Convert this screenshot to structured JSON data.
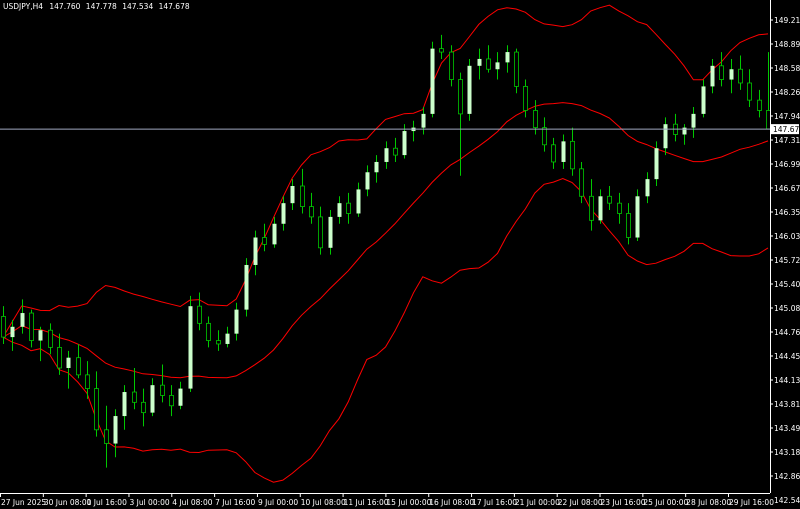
{
  "chart_data": {
    "type": "candlestick",
    "symbol": "USDJPY",
    "timeframe": "H4",
    "ohlc_header": {
      "open": "147.760",
      "high": "147.778",
      "low": "147.534",
      "close": "147.678"
    },
    "current_price": "147.678",
    "y_ticks": [
      "149.215",
      "148.890",
      "148.580",
      "148.260",
      "147.945",
      "147.310",
      "146.990",
      "146.670",
      "146.355",
      "146.035",
      "145.720",
      "145.400",
      "145.085",
      "144.765",
      "144.450",
      "144.130",
      "143.815",
      "143.495",
      "143.180",
      "142.860",
      "142.540"
    ],
    "y_range": [
      142.54,
      149.5
    ],
    "x_ticks": [
      "27 Jun 2025",
      "30 Jun 08:00",
      "1 Jul 16:00",
      "3 Jul 00:00",
      "4 Jul 08:00",
      "7 Jul 16:00",
      "9 Jul 00:00",
      "10 Jul 08:00",
      "11 Jul 16:00",
      "15 Jul 00:00",
      "16 Jul 08:00",
      "17 Jul 16:00",
      "21 Jul 00:00",
      "22 Jul 08:00",
      "23 Jul 16:00",
      "25 Jul 00:00",
      "28 Jul 08:00",
      "29 Jul 16:00"
    ],
    "indicator": "Bollinger Bands",
    "colors": {
      "background": "#000000",
      "bull_candle": "#ccffcc",
      "wick": "#00c800",
      "bear_candle": "#000000",
      "bands": "#ff0000",
      "axis_text": "#ffffff",
      "price_line": "#a0a8c0"
    },
    "candles": [
      [
        144.95,
        145.1,
        144.55,
        144.65
      ],
      [
        144.65,
        144.9,
        144.45,
        144.8
      ],
      [
        144.8,
        145.2,
        144.7,
        145.0
      ],
      [
        145.0,
        145.05,
        144.5,
        144.6
      ],
      [
        144.6,
        144.8,
        144.3,
        144.75
      ],
      [
        144.75,
        144.85,
        144.4,
        144.5
      ],
      [
        144.5,
        144.7,
        144.1,
        144.2
      ],
      [
        144.2,
        144.45,
        143.9,
        144.35
      ],
      [
        144.35,
        144.55,
        144.05,
        144.1
      ],
      [
        144.1,
        144.3,
        143.75,
        143.9
      ],
      [
        143.9,
        144.15,
        143.2,
        143.3
      ],
      [
        143.3,
        143.65,
        142.75,
        143.1
      ],
      [
        143.1,
        143.6,
        142.9,
        143.5
      ],
      [
        143.5,
        143.95,
        143.3,
        143.85
      ],
      [
        143.85,
        144.2,
        143.6,
        143.7
      ],
      [
        143.7,
        143.9,
        143.35,
        143.55
      ],
      [
        143.55,
        144.05,
        143.5,
        143.95
      ],
      [
        143.95,
        144.25,
        143.7,
        143.8
      ],
      [
        143.8,
        143.95,
        143.5,
        143.65
      ],
      [
        143.65,
        144.0,
        143.6,
        143.9
      ],
      [
        143.9,
        145.25,
        143.85,
        145.1
      ],
      [
        145.1,
        145.3,
        144.75,
        144.85
      ],
      [
        144.85,
        144.95,
        144.5,
        144.6
      ],
      [
        144.6,
        144.75,
        144.45,
        144.55
      ],
      [
        144.55,
        144.8,
        144.5,
        144.7
      ],
      [
        144.7,
        145.15,
        144.6,
        145.05
      ],
      [
        145.05,
        145.8,
        144.95,
        145.7
      ],
      [
        145.7,
        146.2,
        145.55,
        146.1
      ],
      [
        146.1,
        146.3,
        145.9,
        146.0
      ],
      [
        146.0,
        146.4,
        145.95,
        146.3
      ],
      [
        146.3,
        146.7,
        146.2,
        146.6
      ],
      [
        146.6,
        146.95,
        146.5,
        146.85
      ],
      [
        146.85,
        147.1,
        146.45,
        146.55
      ],
      [
        146.55,
        146.75,
        146.3,
        146.4
      ],
      [
        146.4,
        146.55,
        145.85,
        145.95
      ],
      [
        145.95,
        146.5,
        145.85,
        146.4
      ],
      [
        146.4,
        146.7,
        146.3,
        146.6
      ],
      [
        146.6,
        146.75,
        146.3,
        146.45
      ],
      [
        146.45,
        146.9,
        146.4,
        146.8
      ],
      [
        146.8,
        147.15,
        146.7,
        147.05
      ],
      [
        147.05,
        147.3,
        146.9,
        147.2
      ],
      [
        147.2,
        147.5,
        147.1,
        147.4
      ],
      [
        147.4,
        147.55,
        147.2,
        147.3
      ],
      [
        147.3,
        147.75,
        147.25,
        147.65
      ],
      [
        147.65,
        147.8,
        147.5,
        147.7
      ],
      [
        147.7,
        148.0,
        147.6,
        147.9
      ],
      [
        147.9,
        148.95,
        147.85,
        148.85
      ],
      [
        148.85,
        149.05,
        148.7,
        148.8
      ],
      [
        148.8,
        148.9,
        148.3,
        148.4
      ],
      [
        148.4,
        148.5,
        147.0,
        147.9
      ],
      [
        147.9,
        148.7,
        147.8,
        148.6
      ],
      [
        148.6,
        148.85,
        148.4,
        148.7
      ],
      [
        148.7,
        148.9,
        148.5,
        148.55
      ],
      [
        148.55,
        148.8,
        148.4,
        148.65
      ],
      [
        148.65,
        148.9,
        148.5,
        148.8
      ],
      [
        148.8,
        148.85,
        148.2,
        148.3
      ],
      [
        148.3,
        148.4,
        147.85,
        147.95
      ],
      [
        147.95,
        148.1,
        147.6,
        147.7
      ],
      [
        147.7,
        147.85,
        147.35,
        147.45
      ],
      [
        147.45,
        147.55,
        147.1,
        147.2
      ],
      [
        147.2,
        147.6,
        147.1,
        147.5
      ],
      [
        147.5,
        147.7,
        147.0,
        147.1
      ],
      [
        147.1,
        147.2,
        146.6,
        146.7
      ],
      [
        146.7,
        146.95,
        146.2,
        146.35
      ],
      [
        146.35,
        146.8,
        146.3,
        146.7
      ],
      [
        146.7,
        146.85,
        146.5,
        146.6
      ],
      [
        146.6,
        146.75,
        146.3,
        146.45
      ],
      [
        146.45,
        146.6,
        146.0,
        146.1
      ],
      [
        146.1,
        146.8,
        146.05,
        146.7
      ],
      [
        146.7,
        147.05,
        146.6,
        146.95
      ],
      [
        146.95,
        147.5,
        146.85,
        147.4
      ],
      [
        147.4,
        147.85,
        147.3,
        147.75
      ],
      [
        147.75,
        147.9,
        147.5,
        147.6
      ],
      [
        147.6,
        147.75,
        147.45,
        147.7
      ],
      [
        147.7,
        148.0,
        147.55,
        147.9
      ],
      [
        147.9,
        148.4,
        147.85,
        148.3
      ],
      [
        148.3,
        148.7,
        148.2,
        148.6
      ],
      [
        148.6,
        148.8,
        148.3,
        148.4
      ],
      [
        148.4,
        148.7,
        148.2,
        148.55
      ],
      [
        148.55,
        148.75,
        148.25,
        148.35
      ],
      [
        148.35,
        148.55,
        148.0,
        148.1
      ],
      [
        148.1,
        148.25,
        147.85,
        147.95
      ],
      [
        147.95,
        148.8,
        147.9,
        147.68
      ]
    ]
  }
}
